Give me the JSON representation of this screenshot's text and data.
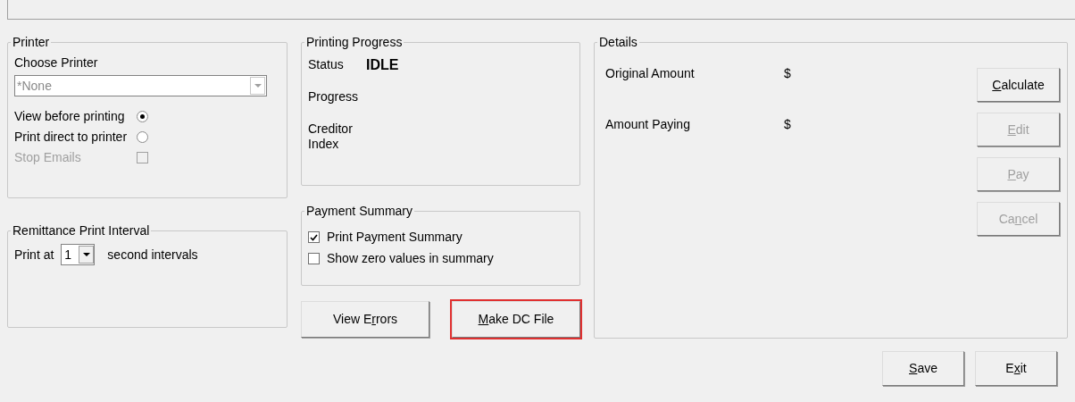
{
  "printer": {
    "title": "Printer",
    "choose_label": "Choose Printer",
    "printer_select": {
      "value": "*None",
      "disabled": true
    },
    "options": [
      {
        "kind": "radio",
        "label": "View before printing",
        "checked": true,
        "disabled": false
      },
      {
        "kind": "radio",
        "label": "Print direct to printer",
        "checked": false,
        "disabled": false
      },
      {
        "kind": "checkbox",
        "label": "Stop Emails",
        "checked": false,
        "disabled": true
      }
    ]
  },
  "interval": {
    "title": "Remittance Print Interval",
    "prefix": "Print at",
    "value": "1",
    "suffix": "second intervals"
  },
  "progress": {
    "title": "Printing Progress",
    "rows": [
      {
        "label": "Status",
        "value": "IDLE"
      },
      {
        "label": "Progress"
      },
      {
        "label": "Creditor\nIndex"
      }
    ]
  },
  "payment_summary": {
    "title": "Payment Summary",
    "options": [
      {
        "label": "Print Payment Summary",
        "checked": true
      },
      {
        "label": "Show zero values in summary",
        "checked": false
      }
    ]
  },
  "middle_buttons": [
    {
      "before": "View E",
      "accel": "r",
      "after": "rors",
      "highlighted": false
    },
    {
      "accel": "M",
      "after": "ake DC File",
      "highlighted": true
    }
  ],
  "details": {
    "title": "Details",
    "rows": [
      {
        "label": "Original Amount",
        "value": "$"
      },
      {
        "label": "Amount Paying",
        "value": "$"
      }
    ],
    "buttons": [
      {
        "accel": "C",
        "after": "alculate",
        "disabled": false
      },
      {
        "accel": "E",
        "after": "dit",
        "disabled": true
      },
      {
        "accel": "P",
        "after": "ay",
        "disabled": true
      },
      {
        "before": "Ca",
        "accel": "n",
        "after": "cel",
        "disabled": true
      }
    ]
  },
  "footer_buttons": [
    {
      "accel": "S",
      "after": "ave"
    },
    {
      "before": "E",
      "accel": "x",
      "after": "it"
    }
  ]
}
